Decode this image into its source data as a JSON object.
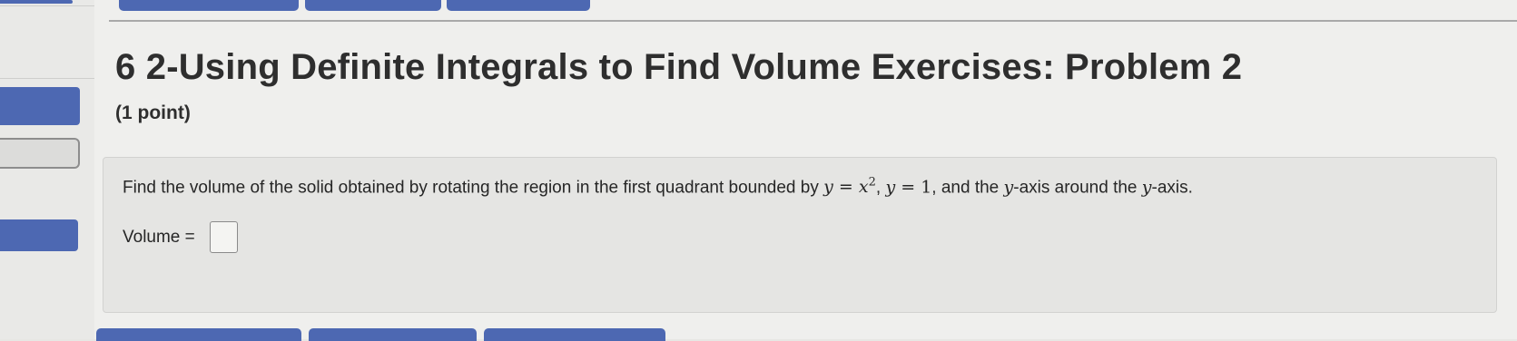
{
  "problem": {
    "title": "6 2-Using Definite Integrals to Find Volume Exercises: Problem 2",
    "points": "(1 point)",
    "statement": {
      "before": "Find the volume of the solid obtained by rotating the region in the first quadrant bounded by ",
      "eq1_lhs": "y",
      "eq1_rhs": "x",
      "eq1_exp": "2",
      "sep": ", ",
      "eq2_lhs": "y",
      "eq2_rhs": "1",
      "mid": ", and the ",
      "var1": "y",
      "mid2": "-axis around the ",
      "var2": "y",
      "end": "-axis."
    },
    "answer_label": "Volume =",
    "answer_value": ""
  },
  "colors": {
    "button_blue": "#4d68b2",
    "page_bg": "#efefed",
    "problem_bg": "#e5e5e3"
  }
}
